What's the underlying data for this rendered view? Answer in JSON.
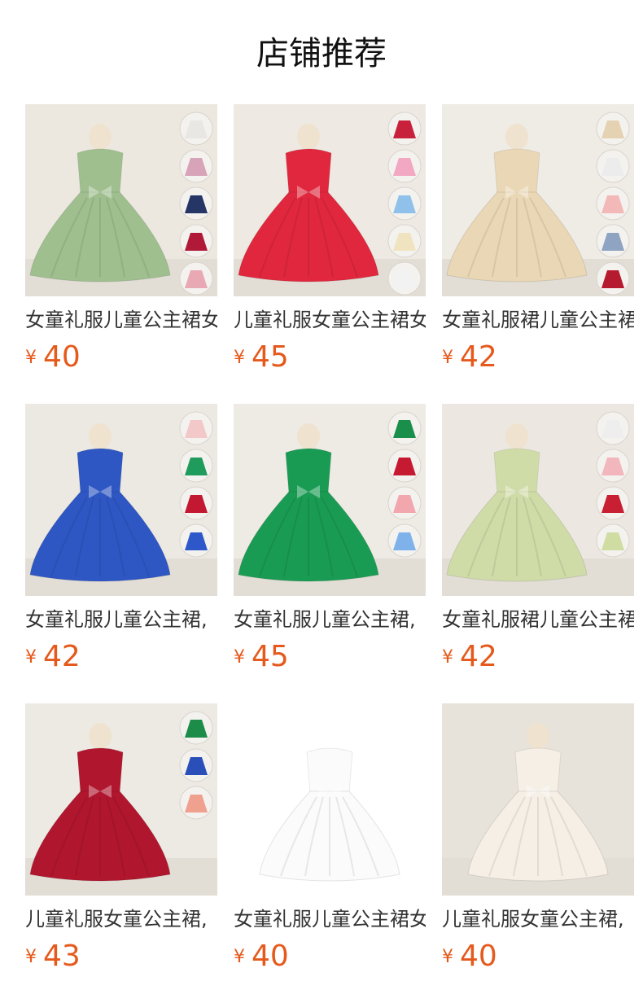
{
  "section": {
    "title": "店铺推荐"
  },
  "products": [
    {
      "name": "女童礼服儿童公主裙女",
      "currency": "¥",
      "price": "40",
      "dress_color": "#9fbf8f",
      "bg": "#ece8e0",
      "swatches": [
        "#e9e7e3",
        "#d7a3b8",
        "#243566",
        "#b01a38",
        "#e8a9b5",
        "#e0c796"
      ]
    },
    {
      "name": "儿童礼服女童公主裙女",
      "currency": "¥",
      "price": "45",
      "dress_color": "#e0273d",
      "bg": "#eee9e2",
      "swatches": [
        "#c8213b",
        "#f2a7c3",
        "#8fc1ea",
        "#efe4bf",
        "#f2f2f2"
      ]
    },
    {
      "name": "女童礼服裙儿童公主裙",
      "currency": "¥",
      "price": "42",
      "dress_color": "#ead7b5",
      "bg": "#efebe5",
      "swatches": [
        "#e5d2b2",
        "#ececec",
        "#f3b9b9",
        "#8fa4c2",
        "#b61a2e"
      ]
    },
    {
      "name": "女童礼服儿童公主裙,",
      "currency": "¥",
      "price": "42",
      "dress_color": "#2e57c4",
      "bg": "#ece9e3",
      "swatches": [
        "#f3c8c8",
        "#1f9b5c",
        "#c21832",
        "#2e58c9"
      ]
    },
    {
      "name": "女童礼服儿童公主裙,",
      "currency": "¥",
      "price": "45",
      "dress_color": "#1a9b53",
      "bg": "#eeeae4",
      "swatches": [
        "#1a8f4c",
        "#c61a33",
        "#f2a6ad",
        "#7fb2eb"
      ]
    },
    {
      "name": "女童礼服裙儿童公主裙",
      "currency": "¥",
      "price": "42",
      "dress_color": "#cfdca8",
      "bg": "#ece8e1",
      "swatches": [
        "#eeeeee",
        "#f1b7bd",
        "#c81f32",
        "#cfdca2"
      ]
    },
    {
      "name": "儿童礼服女童公主裙,",
      "currency": "¥",
      "price": "43",
      "dress_color": "#b0162e",
      "bg": "#ede9e3",
      "swatches": [
        "#1d8c49",
        "#2a4fb8",
        "#f0a08f"
      ]
    },
    {
      "name": "女童礼服儿童公主裙女",
      "currency": "¥",
      "price": "40",
      "dress_color": "#fbfbfb",
      "bg": "#ffffff",
      "swatches": []
    },
    {
      "name": "儿童礼服女童公主裙,",
      "currency": "¥",
      "price": "40",
      "dress_color": "#f5efe6",
      "bg": "#e7e2da",
      "swatches": []
    }
  ]
}
